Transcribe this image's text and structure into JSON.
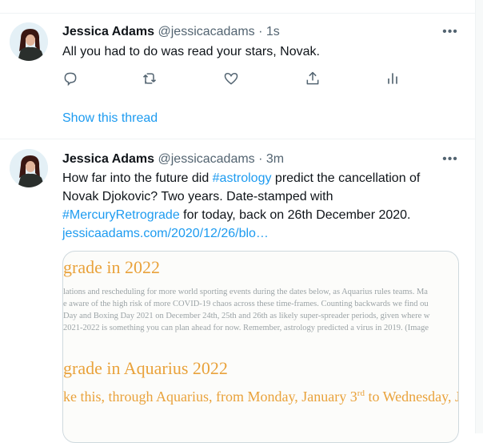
{
  "tweets": [
    {
      "name": "Jessica Adams",
      "handle": "@jessicacadams",
      "separator": "·",
      "time": "1s",
      "text": "All you had to do was read your stars, Novak.",
      "show_thread": "Show this thread"
    },
    {
      "name": "Jessica Adams",
      "handle": "@jessicacadams",
      "separator": "·",
      "time": "3m",
      "text_line1_pre": "How far into the future did ",
      "hashtag1": "#astrology",
      "text_line1_post": " predict the cancellation of",
      "text_line2": "Novak Djokovic? Two years. Date-stamped with",
      "hashtag2": "#MercuryRetrograde",
      "text_line3_post": " for today, back on 26th December 2020.",
      "link": "jessicaadams.com/2020/12/26/blo…",
      "card": {
        "heading1": "grade in 2022",
        "para_lines": [
          "lations and rescheduling for more world sporting events during the dates below, as Aquarius rules teams. Ma",
          "e aware of the high risk of more COVID-19 chaos across these time-frames. Counting backwards we find ou",
          " Day and Boxing Day 2021 on December 24th, 25th and 26th as likely super-spreader periods, given where w",
          "2021-2022 is something you can plan ahead for now. Remember, astrology predicted a virus in 2019. (Image"
        ],
        "heading2": "grade in Aquarius 2022",
        "heading3_pre": "ke this, through Aquarius, from Monday, January 3",
        "heading3_sup": "rd",
        "heading3_post": " to Wednesday, Januar"
      }
    }
  ],
  "icons": {
    "more": "more-horizontal-icon",
    "reply": "reply-bubble-icon",
    "retweet": "retweet-icon",
    "like": "heart-icon",
    "share": "share-icon",
    "analytics": "analytics-bars-icon"
  },
  "colors": {
    "link": "#1d9bf0",
    "muted": "#536471",
    "card_heading": "#e9a23b"
  }
}
